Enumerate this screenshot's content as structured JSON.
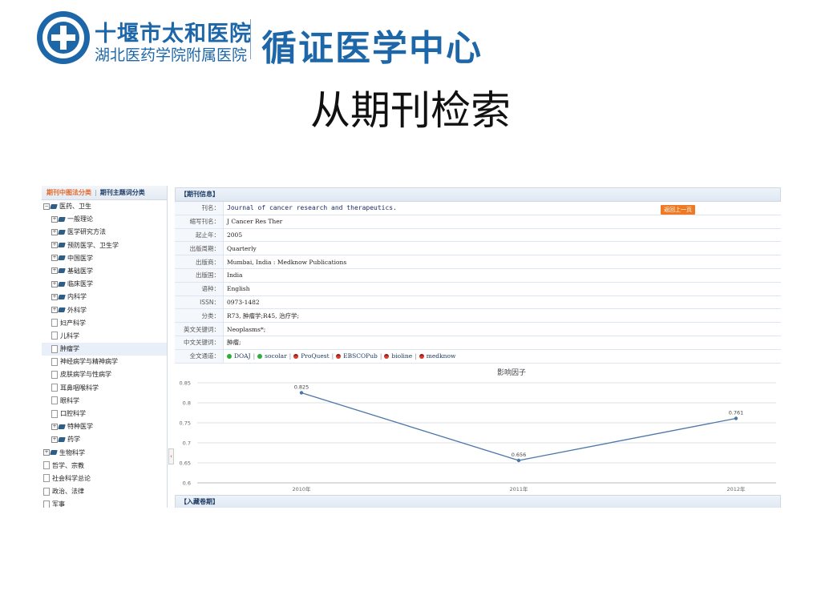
{
  "header": {
    "hospital_name": "十堰市太和医院",
    "hospital_sub": "湖北医药学院附属医院",
    "center_name": "循证医学中心",
    "slide_title": "从期刊检索"
  },
  "left_panel": {
    "tab_classification": "期刊中图法分类",
    "tab_separator": "|",
    "tab_subject": "期刊主题词分类",
    "tree": [
      {
        "label": "医药、卫生",
        "level": 0,
        "expander": "−",
        "icon": "book-icon"
      },
      {
        "label": "一般理论",
        "level": 1,
        "expander": "+",
        "icon": "book-icon"
      },
      {
        "label": "医学研究方法",
        "level": 1,
        "expander": "+",
        "icon": "book-icon"
      },
      {
        "label": "预防医学、卫生学",
        "level": 1,
        "expander": "+",
        "icon": "book-icon"
      },
      {
        "label": "中国医学",
        "level": 1,
        "expander": "+",
        "icon": "book-icon"
      },
      {
        "label": "基础医学",
        "level": 1,
        "expander": "+",
        "icon": "book-icon"
      },
      {
        "label": "临床医学",
        "level": 1,
        "expander": "+",
        "icon": "book-icon"
      },
      {
        "label": "内科学",
        "level": 1,
        "expander": "+",
        "icon": "book-icon"
      },
      {
        "label": "外科学",
        "level": 1,
        "expander": "+",
        "icon": "book-icon"
      },
      {
        "label": "妇产科学",
        "level": 1,
        "expander": "",
        "icon": "doc-icon"
      },
      {
        "label": "儿科学",
        "level": 1,
        "expander": "",
        "icon": "doc-icon"
      },
      {
        "label": "肿瘤学",
        "level": 1,
        "expander": "",
        "icon": "doc-icon",
        "selected": true
      },
      {
        "label": "神经病学与精神病学",
        "level": 1,
        "expander": "",
        "icon": "doc-icon"
      },
      {
        "label": "皮肤病学与性病学",
        "level": 1,
        "expander": "",
        "icon": "doc-icon"
      },
      {
        "label": "耳鼻咽喉科学",
        "level": 1,
        "expander": "",
        "icon": "doc-icon"
      },
      {
        "label": "眼科学",
        "level": 1,
        "expander": "",
        "icon": "doc-icon"
      },
      {
        "label": "口腔科学",
        "level": 1,
        "expander": "",
        "icon": "doc-icon"
      },
      {
        "label": "特种医学",
        "level": 1,
        "expander": "+",
        "icon": "book-icon"
      },
      {
        "label": "药学",
        "level": 1,
        "expander": "+",
        "icon": "book-icon"
      },
      {
        "label": "生物科学",
        "level": 0,
        "expander": "+",
        "icon": "book-icon"
      },
      {
        "label": "哲学、宗教",
        "level": 0,
        "expander": "",
        "icon": "doc-icon"
      },
      {
        "label": "社会科学总论",
        "level": 0,
        "expander": "",
        "icon": "doc-icon"
      },
      {
        "label": "政治、法律",
        "level": 0,
        "expander": "",
        "icon": "doc-icon"
      },
      {
        "label": "军事",
        "level": 0,
        "expander": "",
        "icon": "doc-icon"
      }
    ],
    "collapse_glyph": "‹"
  },
  "journal_info": {
    "section_title": "【期刊信息】",
    "back_button": "返回上一页",
    "fields": [
      {
        "key": "刊名：",
        "value": "Journal of cancer research and therapeutics.",
        "mono": true
      },
      {
        "key": "缩写刊名：",
        "value": "J Cancer Res Ther"
      },
      {
        "key": "起止年：",
        "value": "2005"
      },
      {
        "key": "出版周期：",
        "value": "Quarterly"
      },
      {
        "key": "出版商：",
        "value": "Mumbai, India : Medknow Publications"
      },
      {
        "key": "出版国：",
        "value": "India"
      },
      {
        "key": "语种：",
        "value": "English"
      },
      {
        "key": "ISSN：",
        "value": "0973-1482"
      },
      {
        "key": "分类：",
        "value": "R73, 肿瘤学;R45, 治疗学;"
      },
      {
        "key": "英文关键词：",
        "value": "Neoplasms*;"
      },
      {
        "key": "中文关键词：",
        "value": "肿瘤;"
      }
    ],
    "channels_key": "全文通道：",
    "channels": [
      {
        "name": "DOAJ",
        "status": "green"
      },
      {
        "name": "socolar",
        "status": "green"
      },
      {
        "name": "ProQuest",
        "status": "red"
      },
      {
        "name": "EBSCOPub",
        "status": "red"
      },
      {
        "name": "bioline",
        "status": "red"
      },
      {
        "name": "medknow",
        "status": "red"
      }
    ],
    "channel_separator": "|",
    "colors": {
      "accent_orange": "#f07a24",
      "line_blue": "#4a76a8",
      "header_blue": "#1d67a9"
    }
  },
  "chart_data": {
    "type": "line",
    "title": "影响因子",
    "categories": [
      "2010年",
      "2011年",
      "2012年"
    ],
    "values": [
      0.825,
      0.656,
      0.761
    ],
    "data_labels": [
      "0.825",
      "0.656",
      "0.761"
    ],
    "y_ticks": [
      "0.85",
      "0.8",
      "0.75",
      "0.7",
      "0.65",
      "0.6"
    ],
    "ylim": [
      0.6,
      0.85
    ],
    "grid": true,
    "xlabel": "",
    "ylabel": ""
  },
  "holdings": {
    "section_title": "【入藏卷期】"
  }
}
